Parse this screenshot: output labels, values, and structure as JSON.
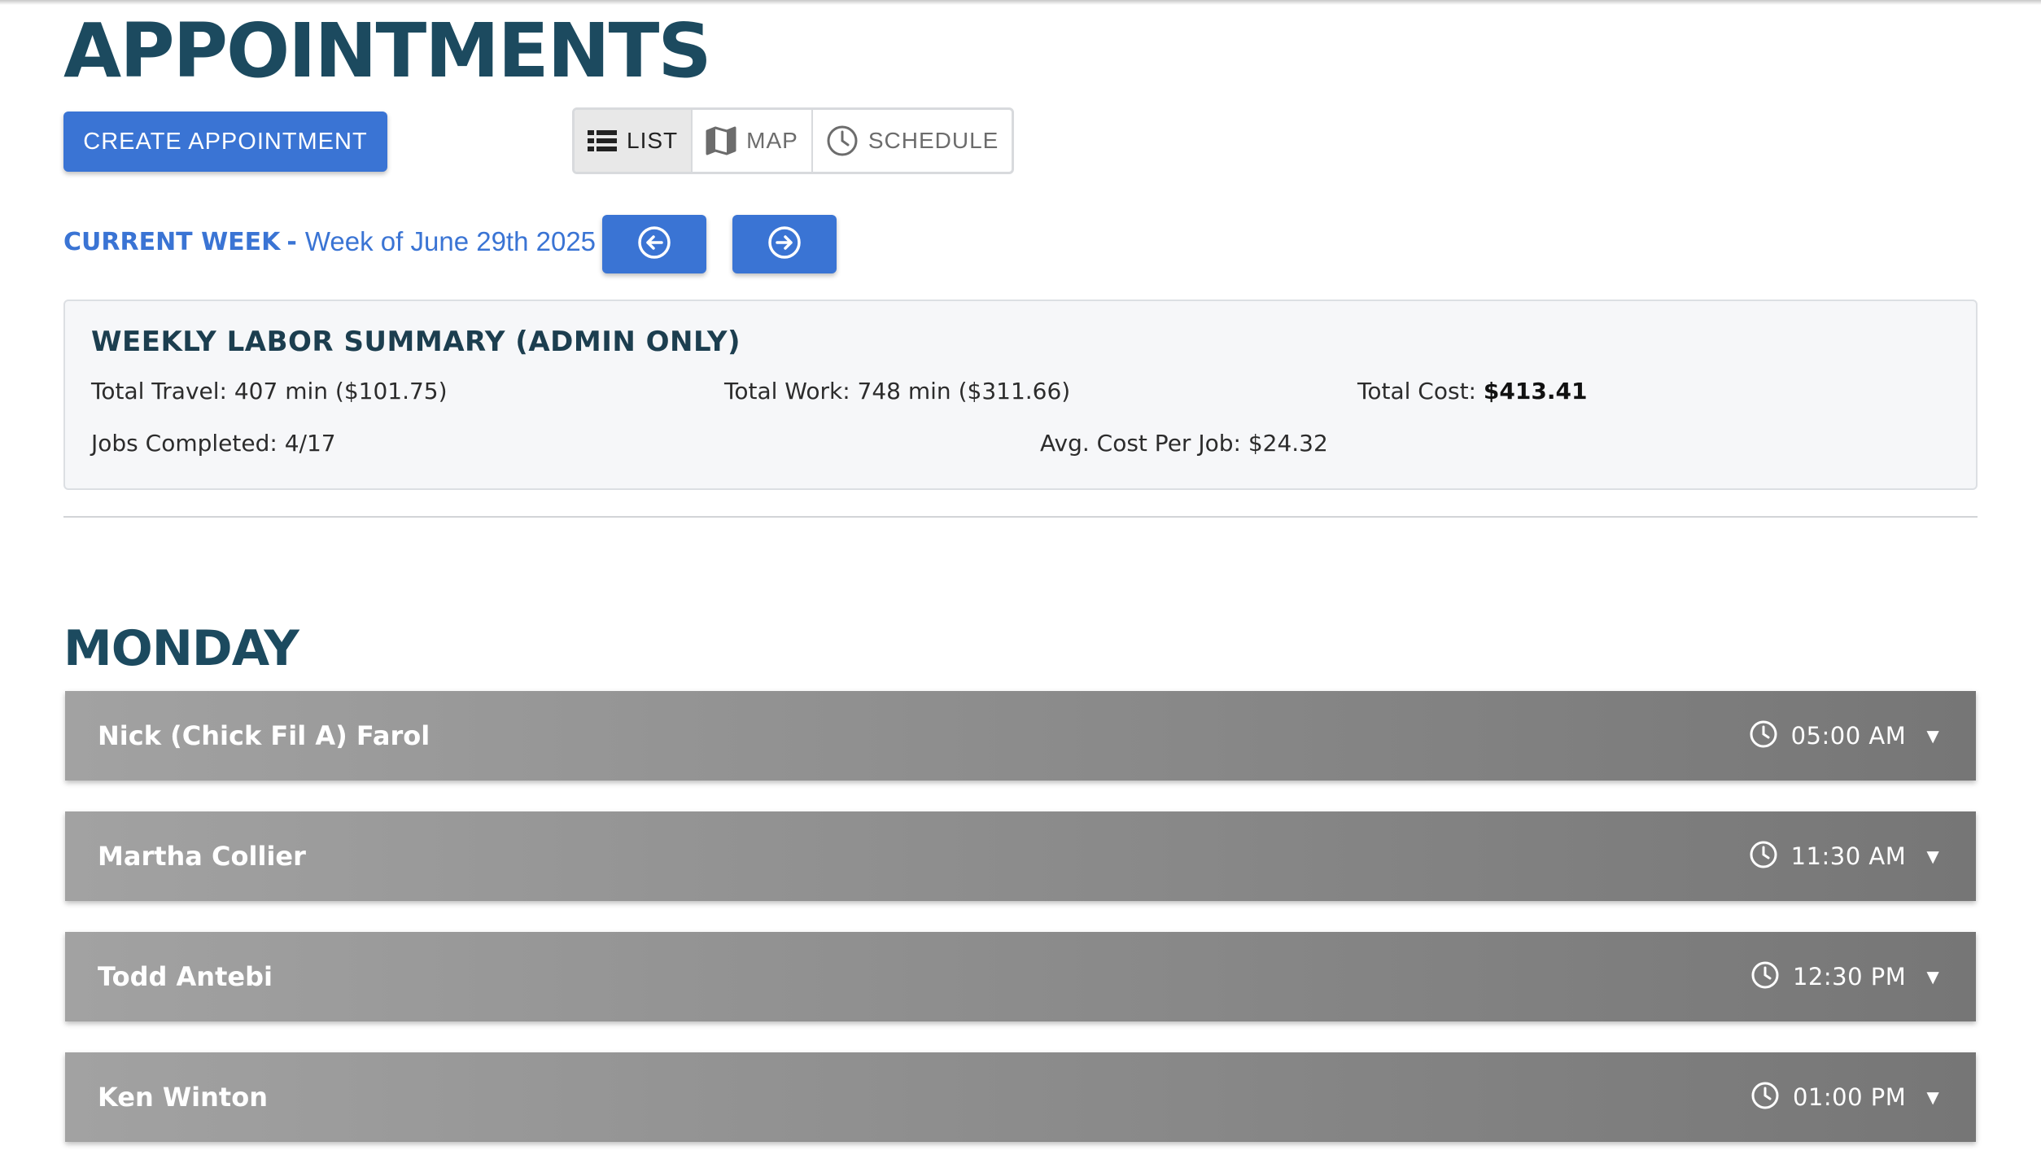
{
  "page": {
    "title": "APPOINTMENTS"
  },
  "toolbar": {
    "create_label": "CREATE APPOINTMENT",
    "views": [
      {
        "label": "LIST",
        "icon": "list-icon",
        "active": true
      },
      {
        "label": "MAP",
        "icon": "map-icon",
        "active": false
      },
      {
        "label": "SCHEDULE",
        "icon": "clock-icon",
        "active": false
      }
    ]
  },
  "week": {
    "label": "CURRENT WEEK",
    "separator": "-",
    "value": "Week of June 29th 2025",
    "prev_icon": "arrow-left-circle-icon",
    "next_icon": "arrow-right-circle-icon"
  },
  "summary": {
    "title": "WEEKLY LABOR SUMMARY (ADMIN ONLY)",
    "total_travel": "Total Travel: 407 min ($101.75)",
    "total_work": "Total Work: 748 min ($311.66)",
    "total_cost_label": "Total Cost:",
    "total_cost_value": "$413.41",
    "jobs_completed": "Jobs Completed: 4/17",
    "avg_cost": "Avg. Cost Per Job: $24.32"
  },
  "days": [
    {
      "name": "MONDAY",
      "appointments": [
        {
          "client": "Nick (Chick Fil A) Farol",
          "time": "05:00 AM"
        },
        {
          "client": "Martha Collier",
          "time": "11:30 AM"
        },
        {
          "client": "Todd Antebi",
          "time": "12:30 PM"
        },
        {
          "client": "Ken Winton",
          "time": "01:00 PM"
        }
      ]
    }
  ],
  "colors": {
    "primary": "#3a74d4",
    "heading": "#1c4a5f",
    "card_bg": "#f6f7f9",
    "appointment_bar": "#8c8c8c"
  }
}
